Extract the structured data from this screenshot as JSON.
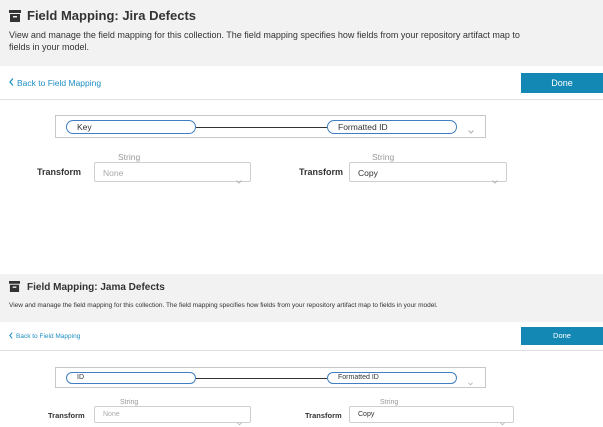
{
  "panels": [
    {
      "title": "Field Mapping: Jira Defects",
      "description": "View and manage the field mapping for this collection. The field mapping specifies how fields from your repository artifact map to fields in your model.",
      "back_link": "Back to Field Mapping",
      "done_label": "Done",
      "source_field": "Key",
      "target_field": "Formatted ID",
      "left_type": "String",
      "right_type": "String",
      "transform_label": "Transform",
      "left_transform": "None",
      "right_transform": "Copy"
    },
    {
      "title": "Field Mapping: Jama Defects",
      "description": "View and manage the field mapping for this collection. The field mapping specifies how fields from your repository artifact map to fields in your model.",
      "back_link": "Back to Field Mapping",
      "done_label": "Done",
      "source_field": "ID",
      "target_field": "Formatted ID",
      "left_type": "String",
      "right_type": "String",
      "transform_label": "Transform",
      "left_transform": "None",
      "right_transform": "Copy"
    }
  ],
  "colors": {
    "accent": "#1488b5",
    "link": "#1f8fc4",
    "pill_border": "#3f7fc1",
    "header_bg": "#f2f2f2"
  },
  "icons": {
    "title": "archive-icon",
    "back": "chevron-left-icon",
    "dropdown": "chevron-down-icon"
  }
}
